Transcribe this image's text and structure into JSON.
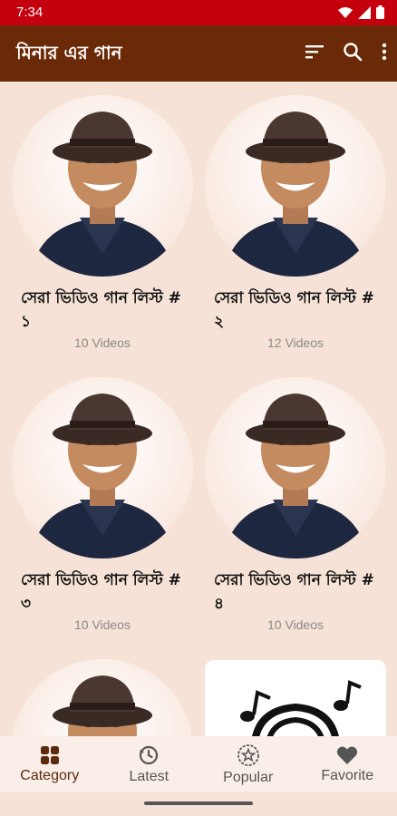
{
  "status": {
    "time": "7:34"
  },
  "app_bar": {
    "title": "মিনার এর গান"
  },
  "cards": [
    {
      "title": "সেরা ভিডিও গান লিস্ট # ১",
      "count": "10 Videos"
    },
    {
      "title": "সেরা ভিডিও গান লিস্ট # ২",
      "count": "12 Videos"
    },
    {
      "title": "সেরা ভিডিও গান লিস্ট # ৩",
      "count": "10 Videos"
    },
    {
      "title": "সেরা ভিডিও গান লিস্ট # ৪",
      "count": "10 Videos"
    }
  ],
  "bottom_nav": {
    "items": [
      {
        "label": "Category",
        "icon": "category-icon",
        "active": true
      },
      {
        "label": "Latest",
        "icon": "history-icon",
        "active": false
      },
      {
        "label": "Popular",
        "icon": "star-badge-icon",
        "active": false
      },
      {
        "label": "Favorite",
        "icon": "heart-icon",
        "active": false
      }
    ]
  },
  "colors": {
    "status_bar": "#c4000e",
    "app_bar": "#6b2a07",
    "background": "#f6e2d6",
    "nav_active": "#5b2a0c"
  }
}
